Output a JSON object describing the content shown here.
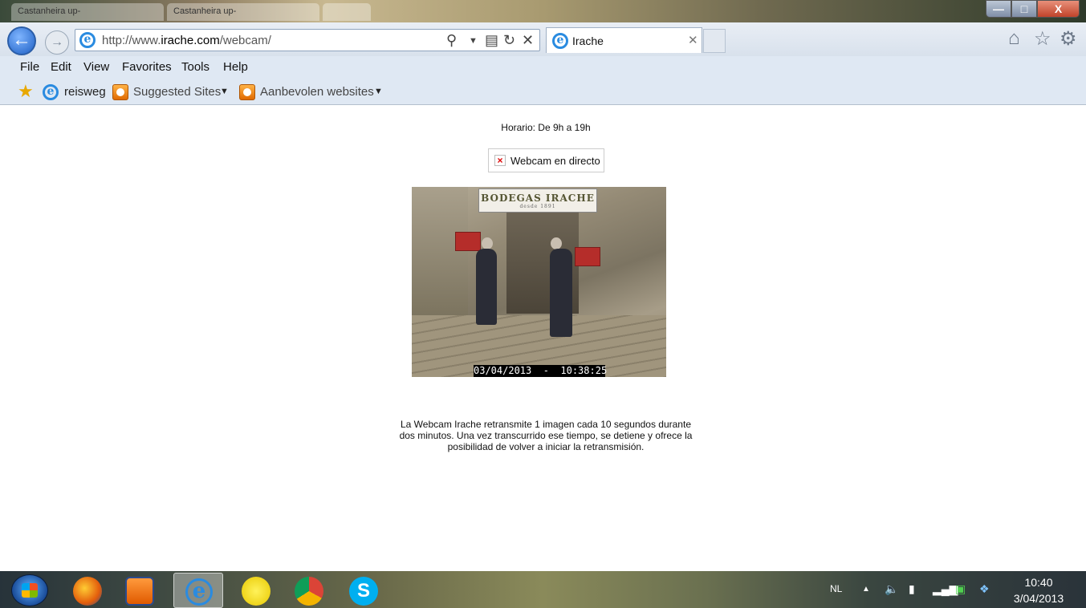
{
  "browser": {
    "background_tabs": [
      "Castanheira up-",
      "Castanheira up-",
      ""
    ],
    "url_prefix": "http://www.",
    "url_domain": "irache.com",
    "url_path": "/webcam/",
    "active_tab": "Irache",
    "window_buttons": {
      "minimize": "—",
      "maximize": "□",
      "close": "X"
    }
  },
  "menu": {
    "items": [
      "File",
      "Edit",
      "View",
      "Favorites",
      "Tools",
      "Help"
    ]
  },
  "favorites": {
    "items": [
      "reisweg",
      "Suggested Sites",
      "Aanbevolen websites"
    ]
  },
  "page": {
    "horario": "Horario: De 9h a 19h",
    "webcam_link": "Webcam en directo",
    "sign_text": "BODEGAS IRACHE",
    "sign_subtext": "desde 1891",
    "timestamp": "03/04/2013  -  10:38:25",
    "description": "La Webcam Irache retransmite 1 imagen cada 10 segundos durante dos minutos. Una vez transcurrido ese tiempo, se detiene y ofrece la posibilidad de volver a iniciar la retransmisión."
  },
  "taskbar": {
    "apps": [
      "firefox",
      "media-player",
      "internet-explorer",
      "smiley-app",
      "chrome",
      "skype"
    ],
    "active_app": "internet-explorer",
    "lang": "NL",
    "time": "10:40",
    "date": "3/04/2013"
  },
  "colors": {
    "ie_blue": "#2a8be0",
    "chrome_bar": "#dfe8f3",
    "close_red": "#c0432a"
  }
}
